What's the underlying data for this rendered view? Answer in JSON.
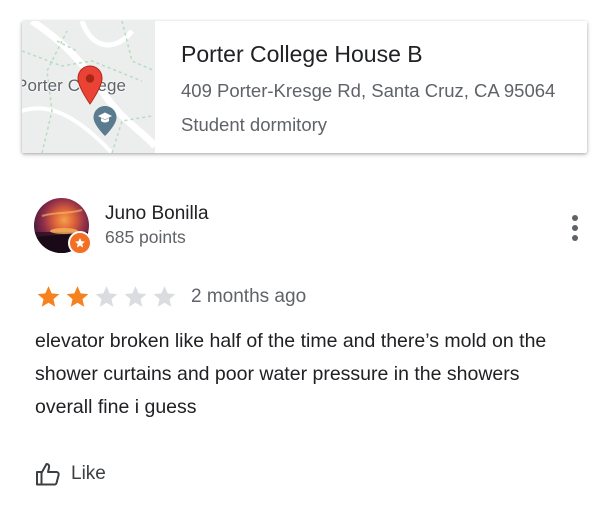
{
  "place": {
    "name": "Porter College House B",
    "address": "409 Porter-Kresge Rd, Santa Cruz, CA 95064",
    "type": "Student dormitory",
    "map_label": "Porter College",
    "pin_color": "#ea4335",
    "poi_icon": "school-icon"
  },
  "review": {
    "author": "Juno Bonilla",
    "points": "685 points",
    "badge_icon": "local-guide-star-icon",
    "rating": 2,
    "max_rating": 5,
    "date": "2 months ago",
    "text": "elevator broken like half of the time and there’s mold on the shower curtains and poor water pressure in the showers overall fine i guess",
    "like_label": "Like",
    "star_color": "#f5811f",
    "star_empty_color": "#dadce0"
  }
}
